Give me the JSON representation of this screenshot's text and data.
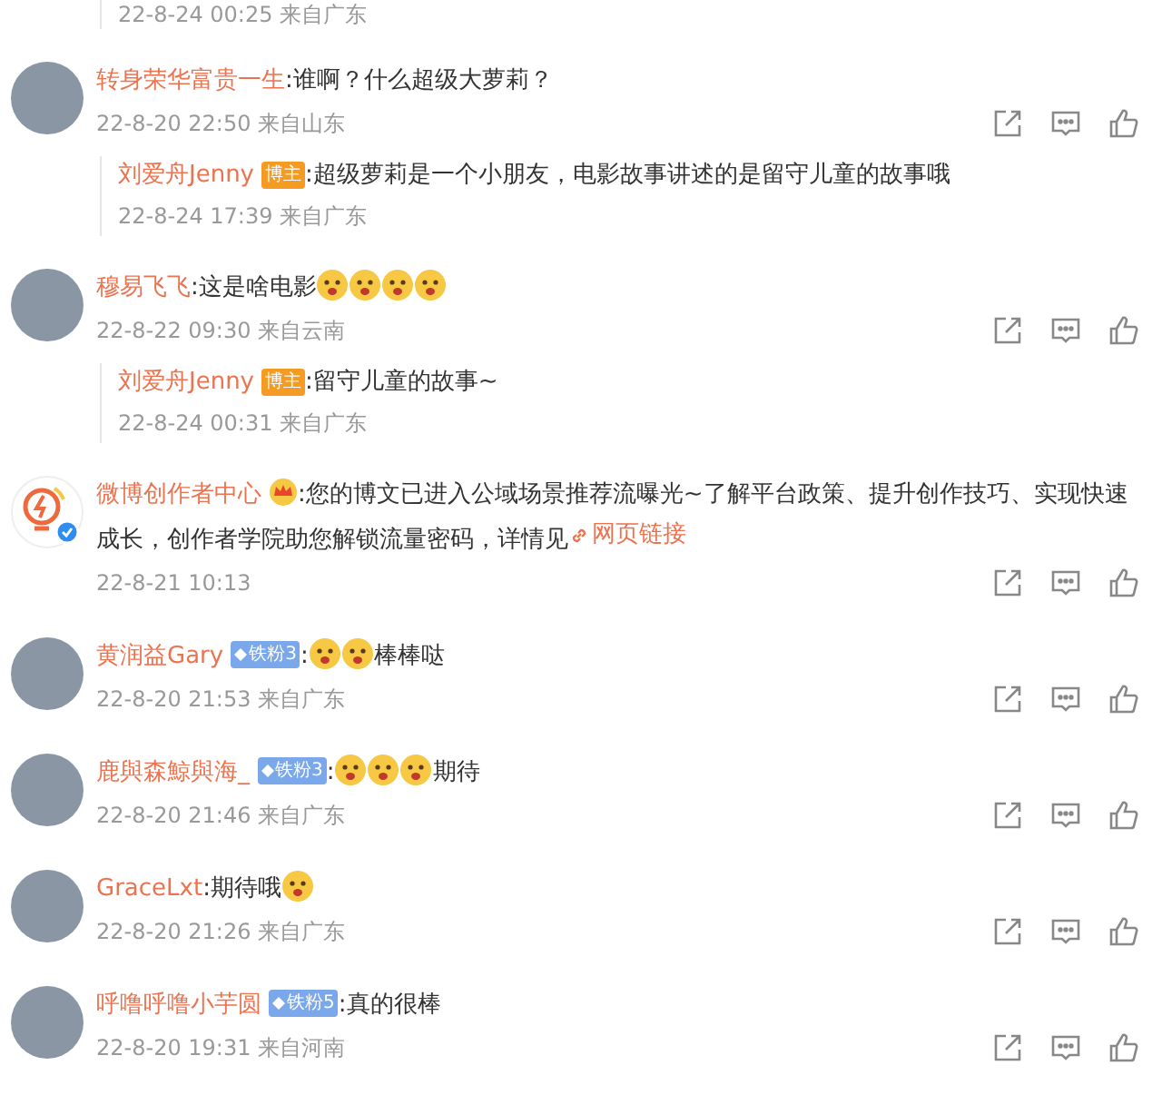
{
  "top_fragment": {
    "meta": "22-8-24 00:25 来自广东"
  },
  "comments": [
    {
      "kind": "user",
      "name": "转身荣华富贵一生",
      "segments": [
        {
          "kind": "text",
          "text": ":谁啊？什么超级大萝莉？"
        }
      ],
      "meta": "22-8-20 22:50 来自山东",
      "replies": [
        {
          "name": "刘爱舟Jenny",
          "badge": {
            "kind": "host",
            "text": "博主"
          },
          "segments": [
            {
              "kind": "text",
              "text": ":超级萝莉是一个小朋友，电影故事讲述的是留守儿童的故事哦"
            }
          ],
          "meta": "22-8-24 17:39 来自广东"
        }
      ]
    },
    {
      "kind": "user",
      "name": "穆易飞飞",
      "segments": [
        {
          "kind": "text",
          "text": ":这是啥电影"
        },
        {
          "kind": "emoji"
        },
        {
          "kind": "emoji"
        },
        {
          "kind": "emoji"
        },
        {
          "kind": "emoji"
        }
      ],
      "meta": "22-8-22 09:30 来自云南",
      "replies": [
        {
          "name": "刘爱舟Jenny",
          "badge": {
            "kind": "host",
            "text": "博主"
          },
          "segments": [
            {
              "kind": "text",
              "text": ":留守儿童的故事~"
            }
          ],
          "meta": "22-8-24 00:31 来自广东"
        }
      ]
    },
    {
      "kind": "official",
      "name": "微博创作者中心",
      "badge": {
        "kind": "crown"
      },
      "segments": [
        {
          "kind": "text",
          "text": ":您的博文已进入公域场景推荐流曝光~了解平台政策、提升创作技巧、实现快速成长，创作者学院助您解锁流量密码，详情见"
        },
        {
          "kind": "link",
          "text": "网页链接"
        }
      ],
      "meta": "22-8-21 10:13"
    },
    {
      "kind": "user",
      "name": "黄润益Gary",
      "badge": {
        "kind": "fan",
        "text": "铁粉3"
      },
      "segments": [
        {
          "kind": "text",
          "text": ":"
        },
        {
          "kind": "emoji"
        },
        {
          "kind": "emoji"
        },
        {
          "kind": "text",
          "text": "棒棒哒"
        }
      ],
      "meta": "22-8-20 21:53 来自广东"
    },
    {
      "kind": "user",
      "name": "鹿與森鯨與海_",
      "badge": {
        "kind": "fan",
        "text": "铁粉3"
      },
      "segments": [
        {
          "kind": "text",
          "text": ":"
        },
        {
          "kind": "emoji"
        },
        {
          "kind": "emoji"
        },
        {
          "kind": "emoji"
        },
        {
          "kind": "text",
          "text": "期待"
        }
      ],
      "meta": "22-8-20 21:46 来自广东"
    },
    {
      "kind": "user",
      "name": "GraceLxt",
      "segments": [
        {
          "kind": "text",
          "text": ":期待哦"
        },
        {
          "kind": "emoji"
        }
      ],
      "meta": "22-8-20 21:26 来自广东"
    },
    {
      "kind": "user",
      "name": "呼噜呼噜小芋圆",
      "badge": {
        "kind": "fan",
        "text": "铁粉5"
      },
      "segments": [
        {
          "kind": "text",
          "text": ":真的很棒"
        }
      ],
      "meta": "22-8-20 19:31 来自河南"
    }
  ]
}
